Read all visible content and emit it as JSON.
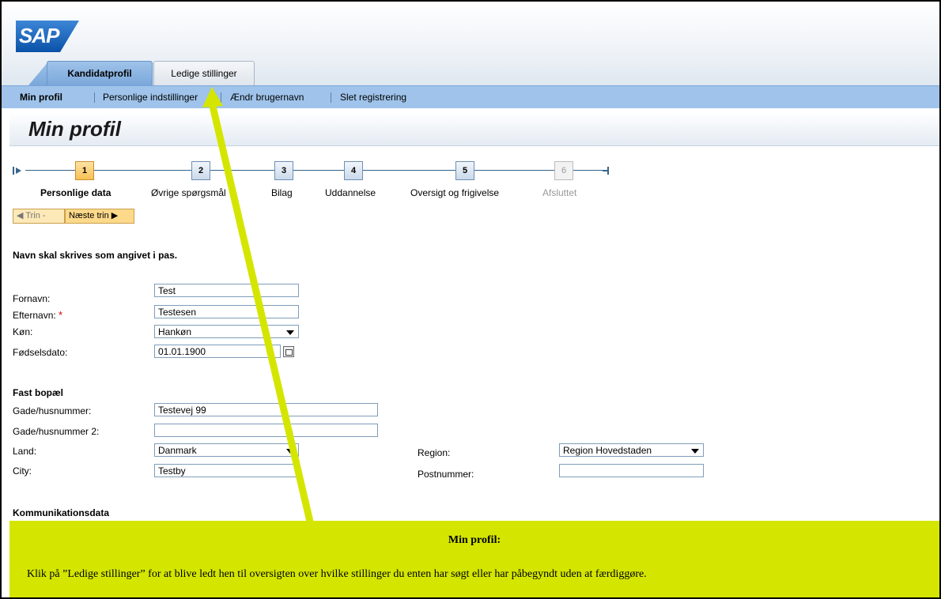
{
  "logo": {
    "text": "SAP"
  },
  "tabs": [
    {
      "label": "Kandidatprofil",
      "active": true
    },
    {
      "label": "Ledige stillinger",
      "active": false
    }
  ],
  "subnav": [
    {
      "label": "Min profil",
      "active": true
    },
    {
      "label": "Personlige indstillinger"
    },
    {
      "label": "Ændr brugernavn"
    },
    {
      "label": "Slet registrering"
    }
  ],
  "page_title": "Min profil",
  "steps": [
    {
      "number": "1",
      "label": "Personlige data",
      "state": "active"
    },
    {
      "number": "2",
      "label": "Øvrige spørgsmål",
      "state": "normal"
    },
    {
      "number": "3",
      "label": "Bilag",
      "state": "normal"
    },
    {
      "number": "4",
      "label": "Uddannelse",
      "state": "normal"
    },
    {
      "number": "5",
      "label": "Oversigt og frigivelse",
      "state": "normal"
    },
    {
      "number": "6",
      "label": "Afsluttet",
      "state": "disabled"
    }
  ],
  "buttons": {
    "prev": "◀ Trin -",
    "next": "Næste trin ▶"
  },
  "name_note": "Navn skal skrives som angivet i pas.",
  "personal": {
    "firstname_label": "Fornavn:",
    "firstname_value": "Test",
    "lastname_label": "Efternavn:",
    "required_mark": "*",
    "lastname_value": "Testesen",
    "gender_label": "Køn:",
    "gender_value": "Hankøn",
    "birthdate_label": "Fødselsdato:",
    "birthdate_value": "01.01.1900"
  },
  "address": {
    "section": "Fast bopæl",
    "street_label": "Gade/husnummer:",
    "street_value": "Testevej 99",
    "street2_label": "Gade/husnummer 2:",
    "street2_value": "",
    "country_label": "Land:",
    "country_value": "Danmark",
    "city_label": "City:",
    "city_value": "Testby",
    "region_label": "Region:",
    "region_value": "Region Hovedstaden",
    "postal_label": "Postnummer:",
    "postal_value": ""
  },
  "communication": {
    "section": "Kommunikationsdata"
  },
  "callout": {
    "title": "Min profil:",
    "body": "Klik på ”Ledige stillinger” for at blive ledt hen til oversigten over hvilke stillinger du enten har søgt eller har påbegyndt uden at færdiggøre.",
    "color": "#d4e600"
  }
}
